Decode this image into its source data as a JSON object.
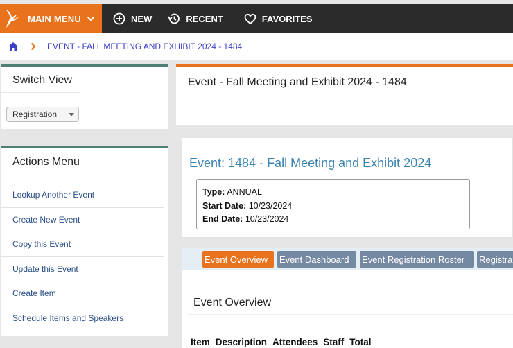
{
  "topnav": {
    "main_menu": "MAIN MENU",
    "items": [
      {
        "label": "NEW",
        "icon": "plus-circle-icon"
      },
      {
        "label": "RECENT",
        "icon": "history-icon"
      },
      {
        "label": "FAVORITES",
        "icon": "heart-icon"
      }
    ]
  },
  "breadcrumb": {
    "current": "EVENT - FALL MEETING AND EXHIBIT 2024 - 1484"
  },
  "switch_view": {
    "title": "Switch View",
    "selected": "Registration"
  },
  "actions_menu": {
    "title": "Actions Menu",
    "items": [
      "Lookup Another Event",
      "Create New Event",
      "Copy this Event",
      "Update this Event",
      "Create Item",
      "Schedule Items and Speakers"
    ]
  },
  "main": {
    "title": "Event - Fall Meeting and Exhibit 2024 - 1484",
    "event_heading_prefix": "Event: ",
    "event_id": "1484",
    "event_heading_suffix": " - Fall Meeting and Exhibit 2024",
    "details": {
      "type_label": "Type:",
      "type_value": "ANNUAL",
      "start_label": "Start Date:",
      "start_value": "10/23/2024",
      "end_label": "End Date:",
      "end_value": "10/23/2024"
    },
    "tabs": [
      "Event Overview",
      "Event Dashboard",
      "Event Registration Roster",
      "Registra"
    ],
    "section_title": "Event Overview",
    "table_headers": [
      "Item",
      "Description",
      "Attendees",
      "Staff",
      "Total"
    ]
  },
  "colors": {
    "accent_orange": "#e8731c",
    "topbar_dark": "#2b2b2b",
    "tab_inactive": "#7689a3",
    "link_blue": "#2a4f8a",
    "heading_blue": "#3a83b0"
  }
}
